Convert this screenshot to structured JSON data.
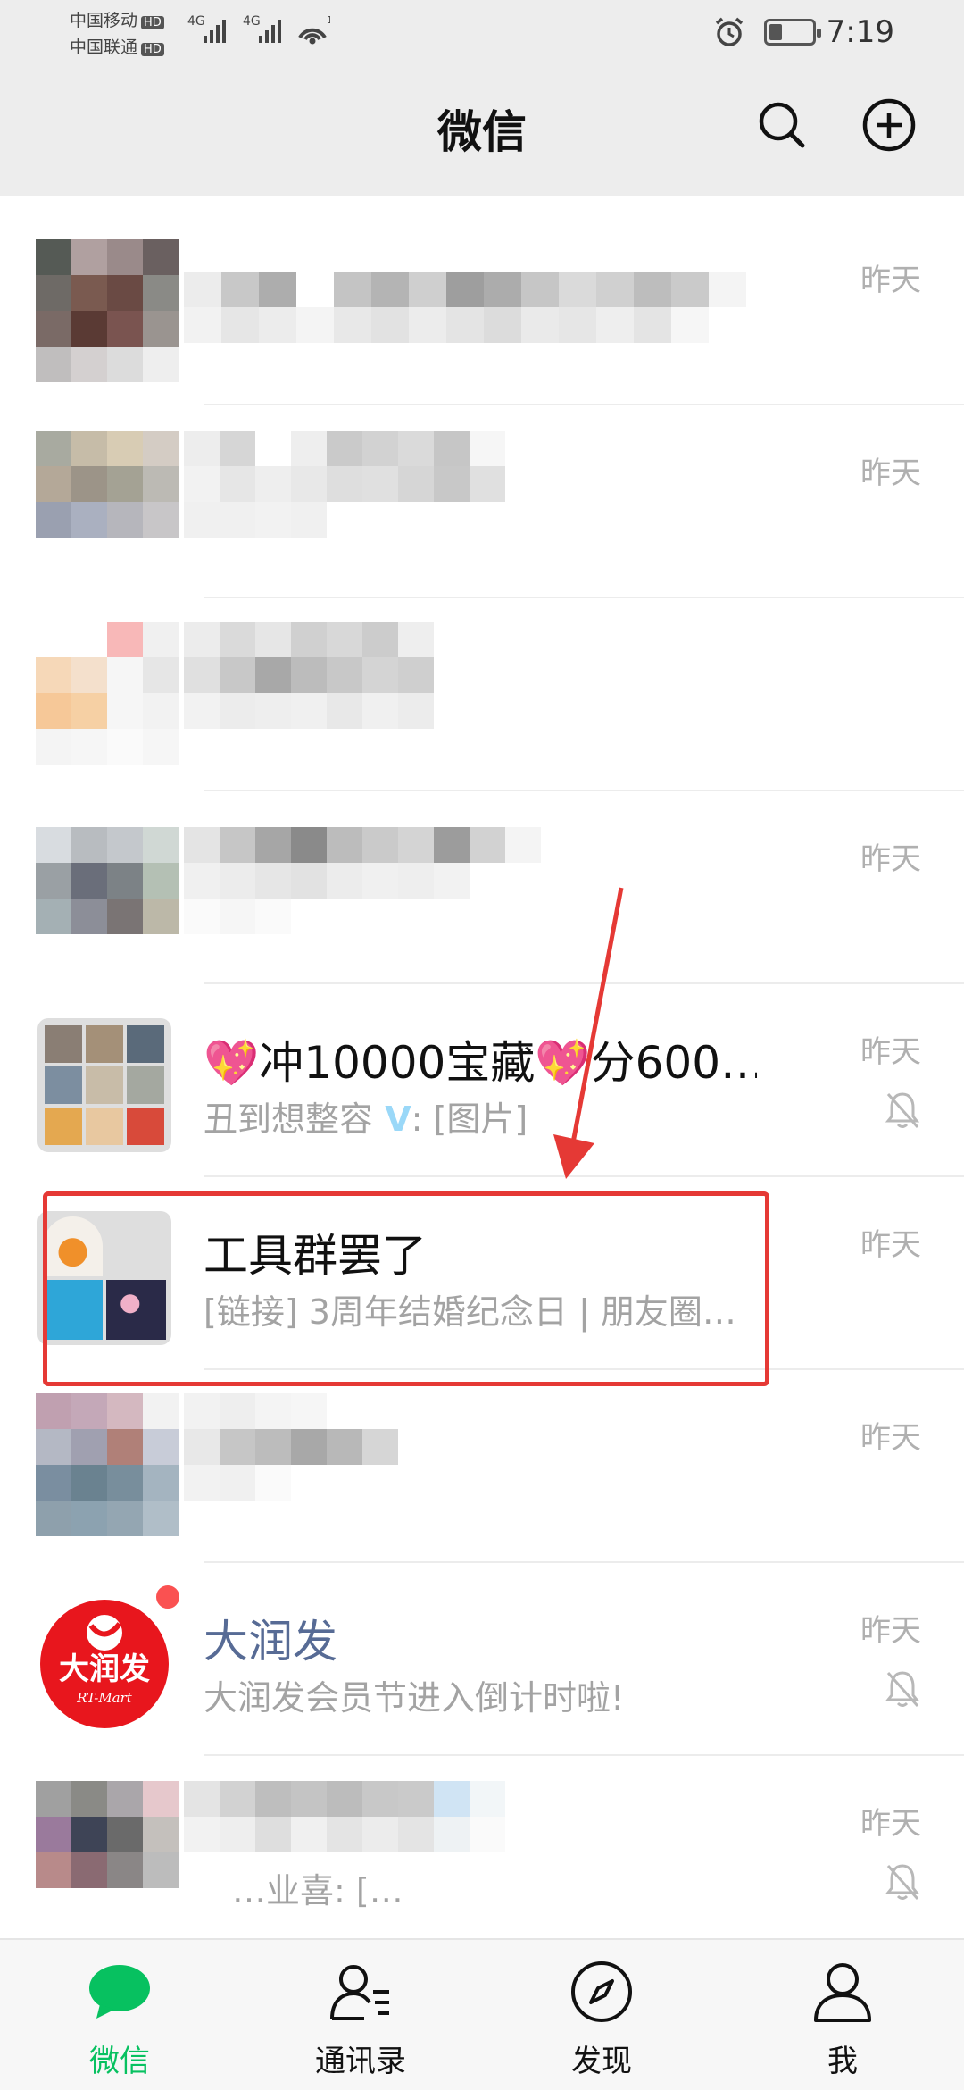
{
  "status_bar": {
    "carrier1": "中国移动",
    "carrier2": "中国联通",
    "hd": "HD",
    "net1": "4G",
    "net2": "4G",
    "wifi_sup": "1",
    "time": "7:19"
  },
  "header": {
    "title": "微信",
    "search_icon": "search-icon",
    "add_icon": "plus-circle-icon"
  },
  "chats": [
    {
      "name": "",
      "preview": "",
      "time": "昨天",
      "muted": false
    },
    {
      "name": "",
      "preview": "",
      "time": "昨天",
      "muted": false
    },
    {
      "name": "",
      "preview": "",
      "time": "",
      "muted": false
    },
    {
      "name": "",
      "preview": "",
      "time": "昨天",
      "muted": false
    },
    {
      "name": "💖冲10000宝藏💖分600…",
      "preview": "丑到想整容",
      "preview_suffix": ": [图片]",
      "time": "昨天",
      "muted": true
    },
    {
      "name": "工具群罢了",
      "preview": "[链接] 3周年结婚纪念日 | 朋友圈…",
      "time": "昨天",
      "muted": false
    },
    {
      "name": "",
      "preview": "",
      "time": "昨天",
      "muted": false
    },
    {
      "name": "大润发",
      "preview": "大润发会员节进入倒计时啦!",
      "time": "昨天",
      "muted": true,
      "unread_dot": true,
      "avatar_text": "大润发",
      "avatar_sub": "RT-Mart"
    },
    {
      "name": "",
      "preview": "…业喜: […",
      "time": "昨天",
      "muted": true
    }
  ],
  "colors": {
    "accent": "#07c160",
    "highlight": "#e53935",
    "badge": "#fa5151",
    "official_name": "#576b95"
  },
  "tabs": [
    {
      "label": "微信",
      "icon": "chat-bubble-icon",
      "active": true
    },
    {
      "label": "通讯录",
      "icon": "contacts-icon",
      "active": false
    },
    {
      "label": "发现",
      "icon": "compass-icon",
      "active": false
    },
    {
      "label": "我",
      "icon": "person-icon",
      "active": false
    }
  ]
}
